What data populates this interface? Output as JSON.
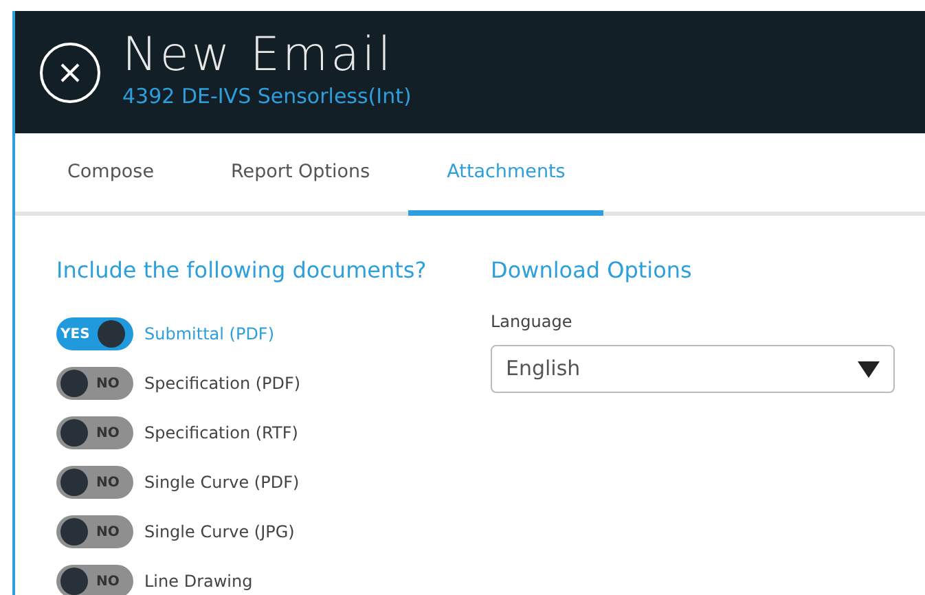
{
  "window": {
    "title": "New Email",
    "subtitle": "4392 DE-IVS Sensorless(Int)"
  },
  "tabs": [
    {
      "label": "Compose",
      "selected": false
    },
    {
      "label": "Report Options",
      "selected": false
    },
    {
      "label": "Attachments",
      "selected": true
    }
  ],
  "documents": {
    "heading": "Include the following documents?",
    "items": [
      {
        "label": "Submittal (PDF)",
        "on": true,
        "switch_text": "YES"
      },
      {
        "label": "Specification (PDF)",
        "on": false,
        "switch_text": "NO"
      },
      {
        "label": "Specification (RTF)",
        "on": false,
        "switch_text": "NO"
      },
      {
        "label": "Single Curve (PDF)",
        "on": false,
        "switch_text": "NO"
      },
      {
        "label": "Single Curve (JPG)",
        "on": false,
        "switch_text": "NO"
      },
      {
        "label": "Line Drawing",
        "on": false,
        "switch_text": "NO"
      }
    ]
  },
  "download_options": {
    "heading": "Download Options",
    "language": {
      "label": "Language",
      "value": "English"
    }
  }
}
